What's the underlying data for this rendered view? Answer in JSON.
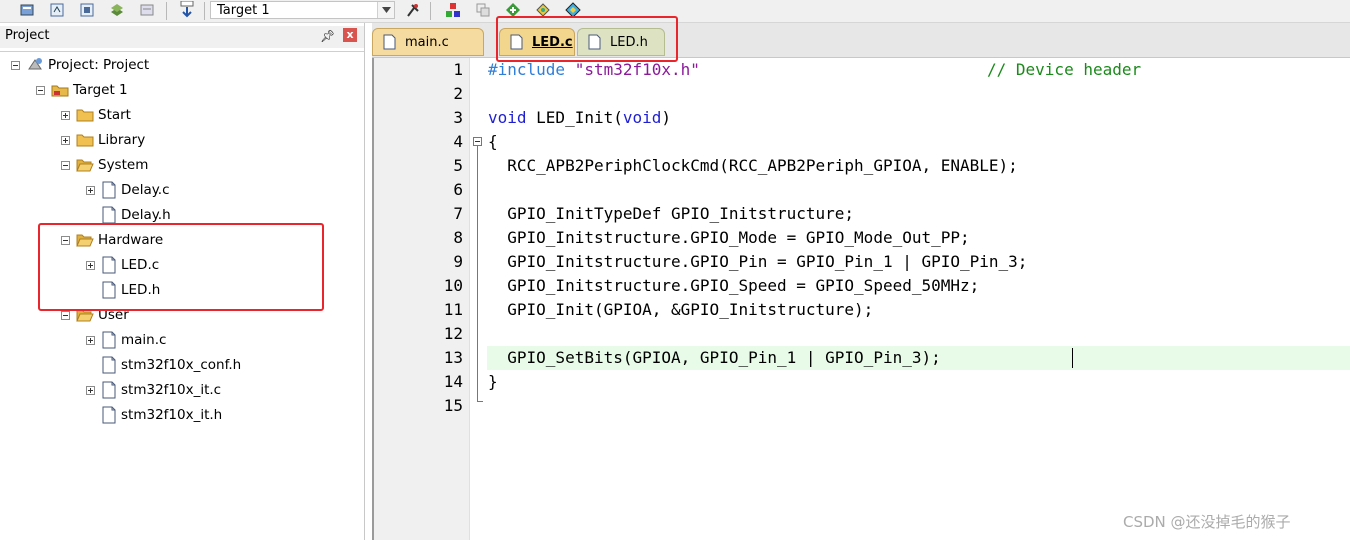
{
  "toolbar": {
    "target": "Target 1",
    "icons": [
      "project-icon",
      "translate-icon",
      "build-icon",
      "batch-build-icon",
      "rebuild-icon",
      "load-icon",
      "dropdown-icon",
      "options-icon",
      "manage-components-icon",
      "copy-icon",
      "pack-installer-icon",
      "magic-wand-icon",
      "rte-icon"
    ]
  },
  "project_panel": {
    "title": "Project",
    "pin": "4",
    "close": "x",
    "tree": [
      {
        "label": "Project: Project",
        "icon": "project-icon"
      },
      {
        "label": "Target 1",
        "icon": "target-folder-icon"
      },
      {
        "label": "Start",
        "icon": "folder-icon"
      },
      {
        "label": "Library",
        "icon": "folder-icon"
      },
      {
        "label": "System",
        "icon": "folder-open-icon"
      },
      {
        "label": "Delay.c",
        "icon": "file-icon"
      },
      {
        "label": "Delay.h",
        "icon": "file-icon"
      },
      {
        "label": "Hardware",
        "icon": "folder-open-icon"
      },
      {
        "label": "LED.c",
        "icon": "file-icon"
      },
      {
        "label": "LED.h",
        "icon": "file-icon"
      },
      {
        "label": "User",
        "icon": "folder-open-icon"
      },
      {
        "label": "main.c",
        "icon": "file-icon"
      },
      {
        "label": "stm32f10x_conf.h",
        "icon": "file-icon"
      },
      {
        "label": "stm32f10x_it.c",
        "icon": "file-icon"
      },
      {
        "label": "stm32f10x_it.h",
        "icon": "file-icon"
      }
    ]
  },
  "editor": {
    "tabs": [
      {
        "label": "main.c",
        "active": false
      },
      {
        "label": "LED.c",
        "active": true
      },
      {
        "label": "LED.h",
        "active": false
      }
    ],
    "line_numbers": [
      "1",
      "2",
      "3",
      "4",
      "5",
      "6",
      "7",
      "8",
      "9",
      "10",
      "11",
      "12",
      "13",
      "14",
      "15"
    ],
    "code": {
      "l1_pp": "#include",
      "l1_str": " \"stm32f10x.h\"",
      "l1_cm": "// Device header",
      "l3_kw1": "void",
      "l3_mid": " LED_Init(",
      "l3_kw2": "void",
      "l3_end": ")",
      "l4": "{",
      "l5": "  RCC_APB2PeriphClockCmd(RCC_APB2Periph_GPIOA, ENABLE);",
      "l7": "  GPIO_InitTypeDef GPIO_Initstructure;",
      "l8": "  GPIO_Initstructure.GPIO_Mode = GPIO_Mode_Out_PP;",
      "l9": "  GPIO_Initstructure.GPIO_Pin = GPIO_Pin_1 | GPIO_Pin_3;",
      "l10": "  GPIO_Initstructure.GPIO_Speed = GPIO_Speed_50MHz;",
      "l11": "  GPIO_Init(GPIOA, &GPIO_Initstructure);",
      "l13": "  GPIO_SetBits(GPIOA, GPIO_Pin_1 | GPIO_Pin_3);",
      "l14": "}"
    }
  },
  "watermark": "CSDN @还没掉毛的猴子",
  "colors": {
    "highlight_box": "#e8262b",
    "keyword": "#1f1fd2",
    "string": "#8b1a99",
    "comment": "#1a8a1a"
  }
}
